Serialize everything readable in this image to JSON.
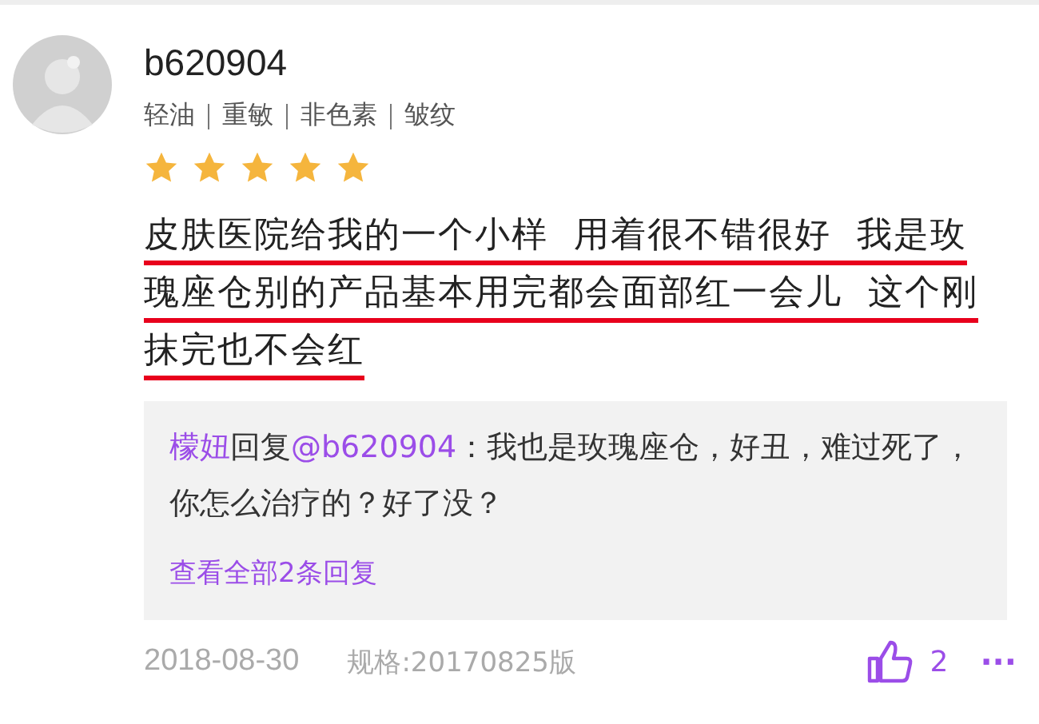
{
  "review": {
    "username": "b620904",
    "tags": [
      "轻油",
      "重敏",
      "非色素",
      "皱纹"
    ],
    "stars": 5,
    "underlined_segments": [
      "皮肤医院给我的一个小样  用着很不错很好  我是玫瑰座仓",
      "别的产品基本用完都会面部红一会儿  这个刚抹完也不会红"
    ],
    "reply": {
      "author": "檬妞",
      "verb": "回复",
      "mention": "@b620904",
      "text": "：我也是玫瑰座仓，好丑，难过死了，你怎么治疗的？好了没？"
    },
    "view_all": "查看全部2条回复",
    "date": "2018-08-30",
    "spec": "规格:20170825版",
    "likes": "2",
    "more": "···"
  }
}
